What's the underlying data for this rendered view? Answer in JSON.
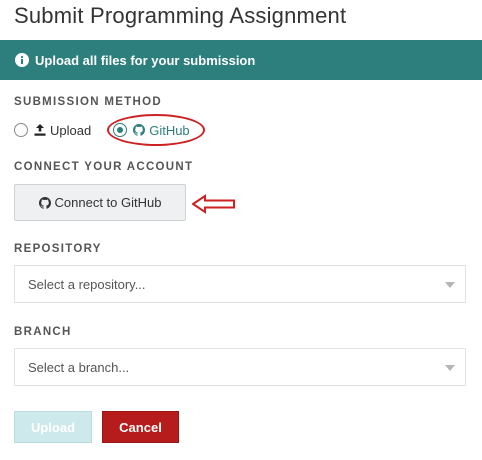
{
  "page_title": "Submit Programming Assignment",
  "banner": {
    "icon": "info-icon",
    "text": "Upload all files for your submission"
  },
  "submission_method": {
    "label": "SUBMISSION METHOD",
    "options": [
      {
        "label": "Upload",
        "icon": "upload-icon",
        "selected": false
      },
      {
        "label": "GitHub",
        "icon": "github-icon",
        "selected": true
      }
    ]
  },
  "connect_account": {
    "label": "CONNECT YOUR ACCOUNT",
    "button_label": "Connect to GitHub"
  },
  "repository": {
    "label": "REPOSITORY",
    "placeholder": "Select a repository..."
  },
  "branch": {
    "label": "BRANCH",
    "placeholder": "Select a branch..."
  },
  "actions": {
    "upload_label": "Upload",
    "cancel_label": "Cancel"
  },
  "colors": {
    "accent": "#2c7f7c",
    "danger": "#b71c1c",
    "annotation": "#cc2222"
  }
}
